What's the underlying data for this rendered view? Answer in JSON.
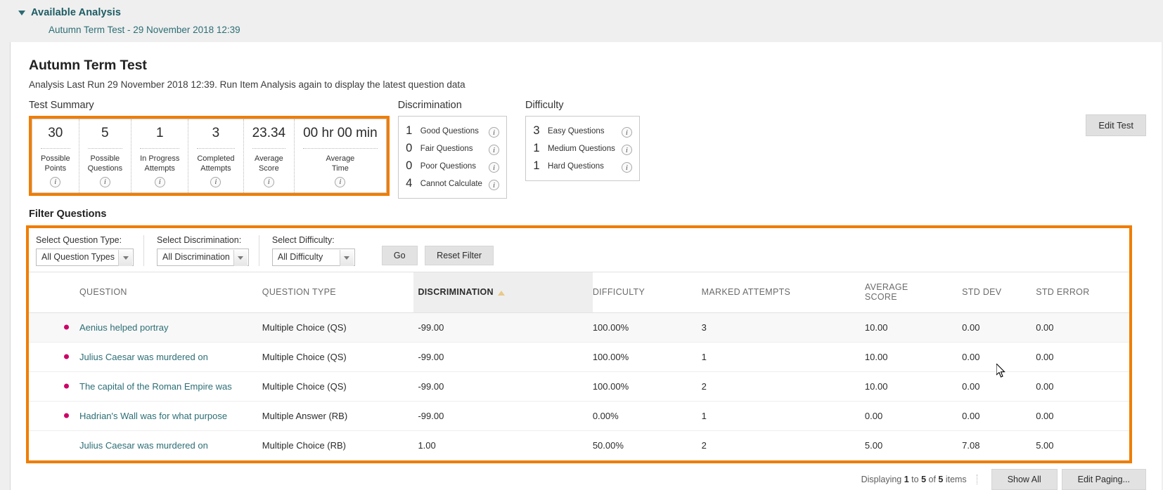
{
  "available": {
    "heading": "Available Analysis",
    "link": "Autumn Term Test - 29 November 2018 12:39",
    "chevron_icon": "chevron-down-icon"
  },
  "page": {
    "title": "Autumn Term Test",
    "subtitle": "Analysis Last Run  29 November 2018 12:39.  Run Item Analysis again to display the latest question data",
    "edit_test": "Edit Test"
  },
  "sections": {
    "test_summary": "Test Summary",
    "discrimination": "Discrimination",
    "difficulty": "Difficulty",
    "filter_questions": "Filter Questions"
  },
  "summary_cells": [
    {
      "value": "30",
      "label_line1": "Possible",
      "label_line2": "Points",
      "info_icon": "info-icon"
    },
    {
      "value": "5",
      "label_line1": "Possible",
      "label_line2": "Questions",
      "info_icon": "info-icon"
    },
    {
      "value": "1",
      "label_line1": "In Progress",
      "label_line2": "Attempts",
      "info_icon": "info-icon"
    },
    {
      "value": "3",
      "label_line1": "Completed",
      "label_line2": "Attempts",
      "info_icon": "info-icon"
    },
    {
      "value": "23.34",
      "label_line1": "Average",
      "label_line2": "Score",
      "info_icon": "info-icon"
    },
    {
      "value": "00 hr 00 min",
      "label_line1": "Average",
      "label_line2": "Time",
      "info_icon": "info-icon"
    }
  ],
  "discrimination_rows": [
    {
      "count": "1",
      "label": "Good Questions",
      "info_icon": "info-icon"
    },
    {
      "count": "0",
      "label": "Fair Questions",
      "info_icon": "info-icon"
    },
    {
      "count": "0",
      "label": "Poor Questions",
      "info_icon": "info-icon"
    },
    {
      "count": "4",
      "label": "Cannot Calculate",
      "info_icon": "info-icon"
    }
  ],
  "difficulty_rows": [
    {
      "count": "3",
      "label": "Easy Questions",
      "info_icon": "info-icon"
    },
    {
      "count": "1",
      "label": "Medium Questions",
      "info_icon": "info-icon"
    },
    {
      "count": "1",
      "label": "Hard Questions",
      "info_icon": "info-icon"
    }
  ],
  "filters": [
    {
      "label": "Select Question Type:",
      "value": "All Question Types"
    },
    {
      "label": "Select Discrimination:",
      "value": "All Discrimination"
    },
    {
      "label": "Select Difficulty:",
      "value": "All Difficulty"
    }
  ],
  "filter_buttons": {
    "go": "Go",
    "reset": "Reset Filter"
  },
  "table": {
    "headers": {
      "question": "QUESTION",
      "question_type": "QUESTION TYPE",
      "discrimination": "DISCRIMINATION",
      "difficulty": "DIFFICULTY",
      "marked_attempts": "MARKED ATTEMPTS",
      "average_score_line1": "AVERAGE",
      "average_score_line2": "SCORE",
      "std_dev": "STD DEV",
      "std_error": "STD ERROR"
    },
    "sort_column": "DISCRIMINATION",
    "sort_icon": "sort-ascending-icon",
    "rows": [
      {
        "marker": true,
        "question": "Aenius helped portray",
        "question_type": "Multiple Choice (QS)",
        "discrimination": "-99.00",
        "difficulty": "100.00%",
        "marked_attempts": "3",
        "average_score": "10.00",
        "std_dev": "0.00",
        "std_error": "0.00"
      },
      {
        "marker": true,
        "question": "Julius Caesar was murdered on",
        "question_type": "Multiple Choice (QS)",
        "discrimination": "-99.00",
        "difficulty": "100.00%",
        "marked_attempts": "1",
        "average_score": "10.00",
        "std_dev": "0.00",
        "std_error": "0.00"
      },
      {
        "marker": true,
        "question": "The capital of the Roman Empire was",
        "question_type": "Multiple Choice (QS)",
        "discrimination": "-99.00",
        "difficulty": "100.00%",
        "marked_attempts": "2",
        "average_score": "10.00",
        "std_dev": "0.00",
        "std_error": "0.00"
      },
      {
        "marker": true,
        "question": "Hadrian's Wall was for what purpose",
        "question_type": "Multiple Answer (RB)",
        "discrimination": "-99.00",
        "difficulty": "0.00%",
        "marked_attempts": "1",
        "average_score": "0.00",
        "std_dev": "0.00",
        "std_error": "0.00"
      },
      {
        "marker": false,
        "question": "Julius Caesar was murdered on",
        "question_type": "Multiple Choice (RB)",
        "discrimination": "1.00",
        "difficulty": "50.00%",
        "marked_attempts": "2",
        "average_score": "5.00",
        "std_dev": "7.08",
        "std_error": "5.00"
      }
    ]
  },
  "footer": {
    "displaying_prefix": "Displaying ",
    "from": "1",
    "mid": " to ",
    "to": "5",
    "of": " of ",
    "total": "5",
    "suffix": " items",
    "show_all": "Show All",
    "edit_paging": "Edit Paging..."
  },
  "colors": {
    "highlight": "#f07d00",
    "link": "#2c6e75",
    "marker": "#cc0066",
    "page_bg": "#efefef"
  }
}
